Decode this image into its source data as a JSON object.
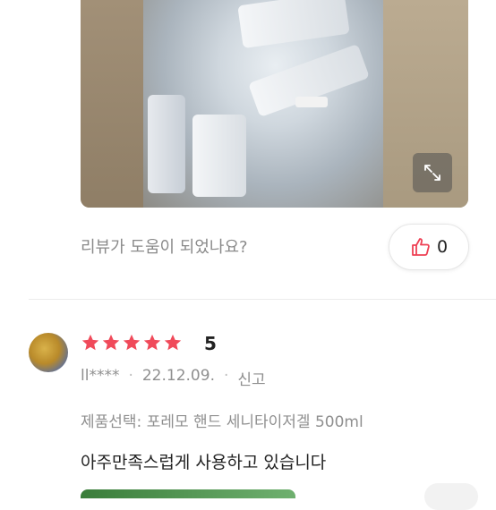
{
  "photo": {
    "expand_icon": "expand-arrows-icon"
  },
  "helpful": {
    "question": "리뷰가 도움이 되었나요?",
    "like_icon": "thumbs-up-icon",
    "like_count": "0"
  },
  "review": {
    "rating": 5,
    "rating_label": "5",
    "star_color": "#f04a5a",
    "user": "ll****",
    "date": "22.12.09.",
    "report_label": "신고",
    "separator": "·",
    "option_text": "제품선택: 포레모 핸드 세니타이저겔 500ml",
    "body": "아주만족스럽게 사용하고 있습니다"
  }
}
